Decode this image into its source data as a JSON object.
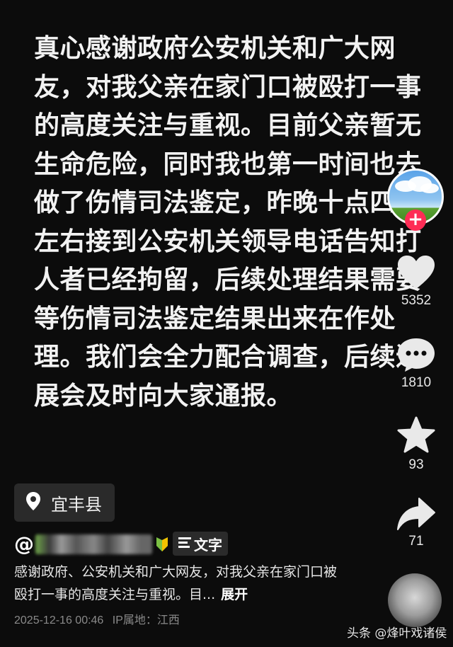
{
  "post": {
    "text": "真心感谢政府公安机关和广大网友，对我父亲在家门口被殴打一事的高度关注与重视。目前父亲暂无生命危险，同时我也第一时间也去做了伤情司法鉴定，昨晚十点四十左右接到公安机关领导电话告知打人者已经拘留，后续处理结果需要等伤情司法鉴定结果出来在作处理。我们会全力配合调查，后续进展会及时向大家通报。"
  },
  "rail": {
    "follow_label": "+",
    "likes": "5352",
    "comments": "1810",
    "favorites": "93",
    "shares": "71"
  },
  "location": {
    "label": "宜丰县",
    "icon": "location-pin-icon"
  },
  "author": {
    "prefix": "@"
  },
  "text_tag": {
    "label": "文字",
    "icon": "text-lines-icon"
  },
  "caption": {
    "text": "感谢政府、公安机关和广大网友，对我父亲在家门口被殴打一事的高度关注与重视。目...",
    "expand_label": "展开"
  },
  "meta": {
    "datetime": "2025-12-16 00:46",
    "ip_location": "IP属地：江西"
  },
  "watermark": {
    "text": "头条 @烽叶戏诸侯"
  },
  "colors": {
    "background": "#0c0c0c",
    "follow_accent": "#fe2c55",
    "chip": "#2a2a2a"
  }
}
